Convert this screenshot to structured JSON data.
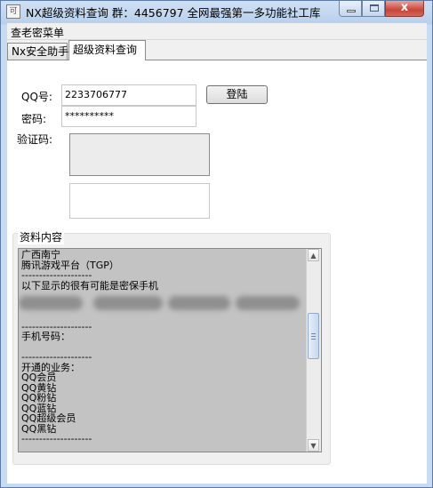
{
  "window": {
    "title": "NX超级资料查询 群：4456797 全网最强第一多功能社工库",
    "icon_name": "app-icon",
    "icon_text": "可",
    "close_glyph": "x"
  },
  "menu": {
    "items": [
      "查老密菜单"
    ]
  },
  "tabs": [
    {
      "label": "Nx安全助手",
      "active": false
    },
    {
      "label": "超级资料查询",
      "active": true
    }
  ],
  "form": {
    "qq_label": "QQ号:",
    "qq_value": "2233706777",
    "password_label": "密码:",
    "password_value": "**********",
    "captcha_label": "验证码:",
    "login_button": "登陆"
  },
  "info": {
    "group_title": "资料内容",
    "lines": [
      "广西南宁",
      "腾讯游戏平台（TGP）",
      "--------------------",
      "以下显示的很有可能是密保手机",
      "",
      "",
      "",
      "--------------------",
      "手机号码：",
      "",
      "--------------------",
      "开通的业务：",
      "QQ会员",
      "QQ黄钻",
      "QQ粉钻",
      "QQ蓝钻",
      "QQ超级会员",
      "QQ黑钻",
      "--------------------"
    ]
  },
  "colors": {
    "title_bar": "#b8d0ec",
    "close_button": "#c8453a",
    "memo_background": "#c3c3c3"
  }
}
